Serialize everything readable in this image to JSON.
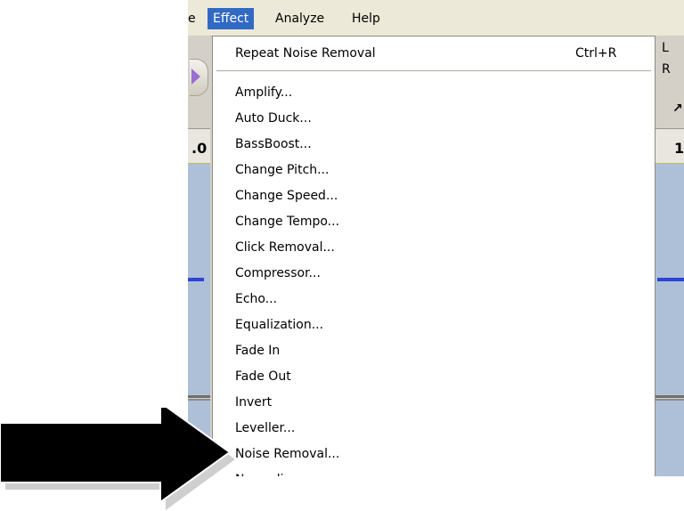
{
  "menubar": {
    "items": [
      "e",
      "Effect",
      "Analyze",
      "Help"
    ]
  },
  "ruler": {
    "left_text": ".0",
    "right_text": "1"
  },
  "channels": {
    "left": "L",
    "right": "R",
    "extra": "↗"
  },
  "effect_menu": {
    "repeat_label": "Repeat Noise Removal",
    "repeat_shortcut": "Ctrl+R",
    "items": [
      "Amplify...",
      "Auto Duck...",
      "BassBoost...",
      "Change Pitch...",
      "Change Speed...",
      "Change Tempo...",
      "Click Removal...",
      "Compressor...",
      "Echo...",
      "Equalization...",
      "Fade In",
      "Fade Out",
      "Invert",
      "Leveller...",
      "Noise Removal...",
      "Normalize..."
    ]
  },
  "colors": {
    "menu_highlight": "#316ac5",
    "waveform": "#2d44d6",
    "track_bg": "#aebfd8",
    "arrow": "#000000"
  }
}
